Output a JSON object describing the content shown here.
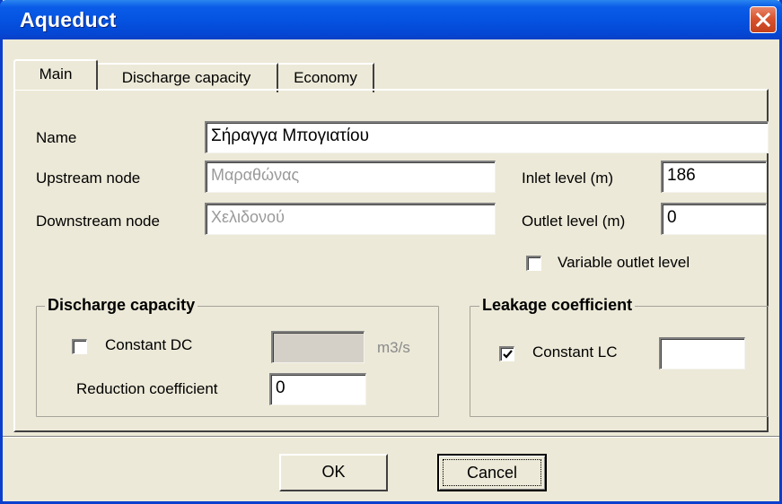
{
  "window": {
    "title": "Aqueduct",
    "close_icon": "close-x-icon"
  },
  "tabs": [
    {
      "label": "Main",
      "active": true
    },
    {
      "label": "Discharge capacity",
      "active": false
    },
    {
      "label": "Economy",
      "active": false
    }
  ],
  "fields": {
    "name": {
      "label": "Name",
      "value": "Σήραγγα Μπογιατίου"
    },
    "upstream": {
      "label": "Upstream node",
      "value": "Μαραθώνας"
    },
    "downstream": {
      "label": "Downstream node",
      "value": "Χελιδονού"
    },
    "inlet": {
      "label": "Inlet level (m)",
      "value": "186"
    },
    "outlet": {
      "label": "Outlet level (m)",
      "value": "0"
    },
    "variable_outlet": {
      "label": "Variable outlet level",
      "checked": false
    }
  },
  "discharge_group": {
    "title": "Discharge capacity",
    "constant_dc": {
      "label": "Constant DC",
      "checked": false,
      "value": ""
    },
    "unit": "m3/s",
    "reduction": {
      "label": "Reduction coefficient",
      "value": "0"
    }
  },
  "leakage_group": {
    "title": "Leakage coefficient",
    "constant_lc": {
      "label": "Constant LC",
      "checked": true,
      "value": ""
    }
  },
  "buttons": {
    "ok": "OK",
    "cancel": "Cancel"
  }
}
